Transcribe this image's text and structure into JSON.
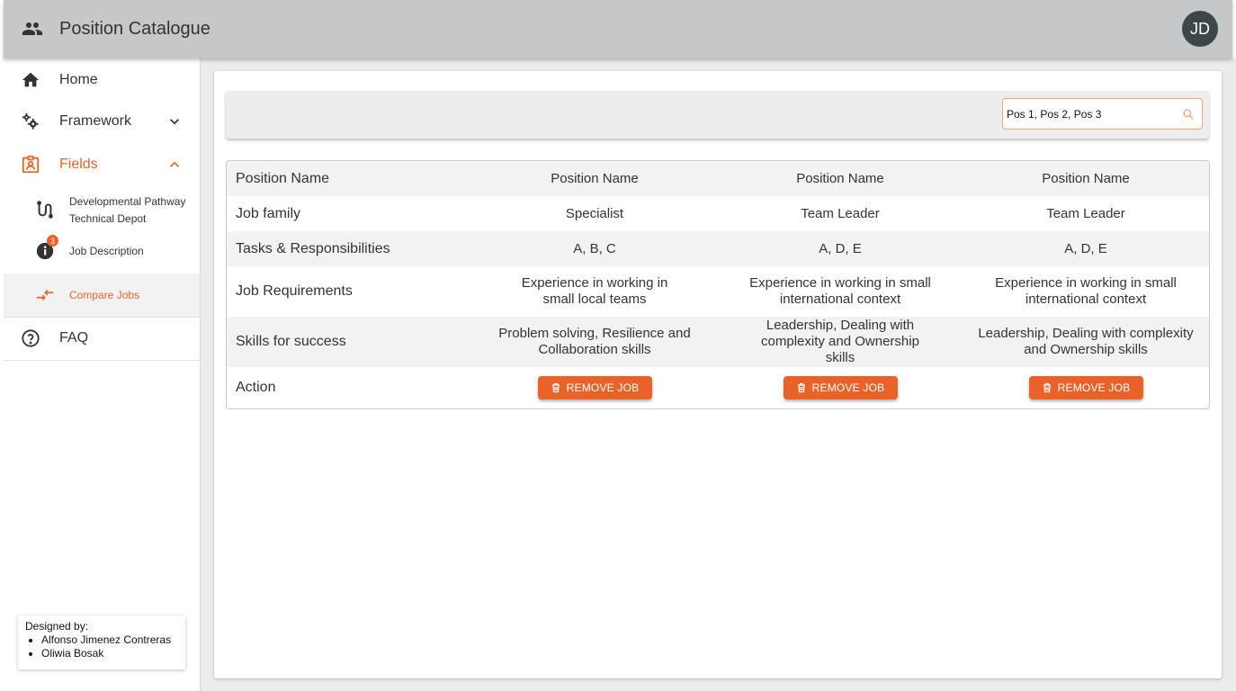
{
  "app": {
    "title": "Position Catalogue",
    "avatar_initials": "JD"
  },
  "sidebar": {
    "home": "Home",
    "framework": "Framework",
    "fields": "Fields",
    "sub_items": [
      {
        "label_line1": "Developmental Pathway",
        "label_line2": "Technical Depot"
      },
      {
        "label": "Job Description",
        "badge": "3"
      },
      {
        "label": "Compare Jobs"
      }
    ],
    "faq": "FAQ"
  },
  "credits": {
    "heading": "Designed by:",
    "names": [
      "Alfonso Jimenez Contreras",
      "Oliwia Bosak"
    ]
  },
  "search": {
    "value": "Pos 1, Pos 2, Pos 3"
  },
  "table": {
    "rows": [
      {
        "label": "Position Name",
        "values": [
          "Position Name",
          "Position Name",
          "Position Name"
        ]
      },
      {
        "label": "Job family",
        "values": [
          "Specialist",
          "Team Leader",
          "Team Leader"
        ]
      },
      {
        "label": "Tasks & Responsibilities",
        "values": [
          "A, B, C",
          "A, D, E",
          "A, D, E"
        ]
      },
      {
        "label": "Job Requirements",
        "values": [
          "Experience in working in small local teams",
          "Experience in working in small international context",
          "Experience in working in small international context"
        ]
      },
      {
        "label": "Skills for success",
        "values": [
          "Problem solving, Resilience and Collaboration skills",
          "Leadership, Dealing with complexity and Ownership skills",
          "Leadership, Dealing with complexity and Ownership skills"
        ]
      },
      {
        "label": "Action",
        "button_label": "REMOVE JOB"
      }
    ]
  },
  "colors": {
    "accent": "#e8632a",
    "appbar": "#c5c8c9",
    "avatar": "#3c4749"
  }
}
